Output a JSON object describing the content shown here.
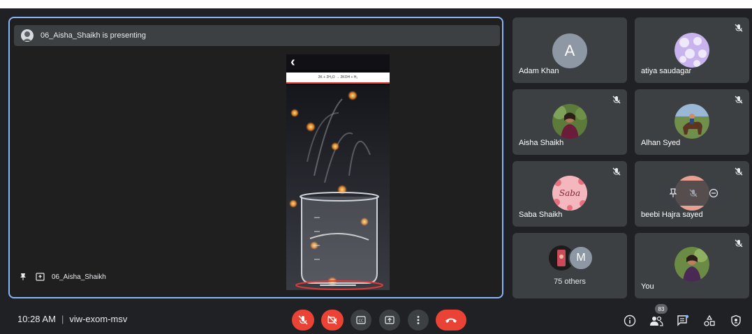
{
  "stage": {
    "presenting_text": "06_Aisha_Shaikh is presenting",
    "footer_name": "06_Aisha_Shaikh",
    "equation": "2K + 2H₂O → 2KOH + H₂"
  },
  "participants": [
    {
      "name": "Adam Khan",
      "letter": "A",
      "muted": false
    },
    {
      "name": "atiya saudagar",
      "muted": true
    },
    {
      "name": "Aisha Shaikh",
      "muted": true
    },
    {
      "name": "Alhan Syed",
      "muted": true
    },
    {
      "name": "Saba Shaikh",
      "muted": true,
      "avatar_text": "Saba"
    },
    {
      "name": "beebi Hajra sayed",
      "muted": true
    },
    {
      "others_label": "75 others",
      "letter": "M"
    },
    {
      "name": "You",
      "muted": true
    }
  ],
  "meeting": {
    "time": "10:28 AM",
    "separator": "|",
    "code": "viw-exom-msv",
    "participant_count": "83"
  },
  "colors": {
    "accent": "#8ab4f8",
    "danger": "#ea4335",
    "tile": "#3c4043",
    "background": "#202124"
  },
  "icons": {
    "controls": [
      "mic-off-icon",
      "camera-off-icon",
      "captions-icon",
      "present-icon",
      "more-icon",
      "end-call-icon"
    ],
    "right": [
      "info-icon",
      "people-icon",
      "chat-icon",
      "activities-icon",
      "host-controls-icon"
    ]
  }
}
